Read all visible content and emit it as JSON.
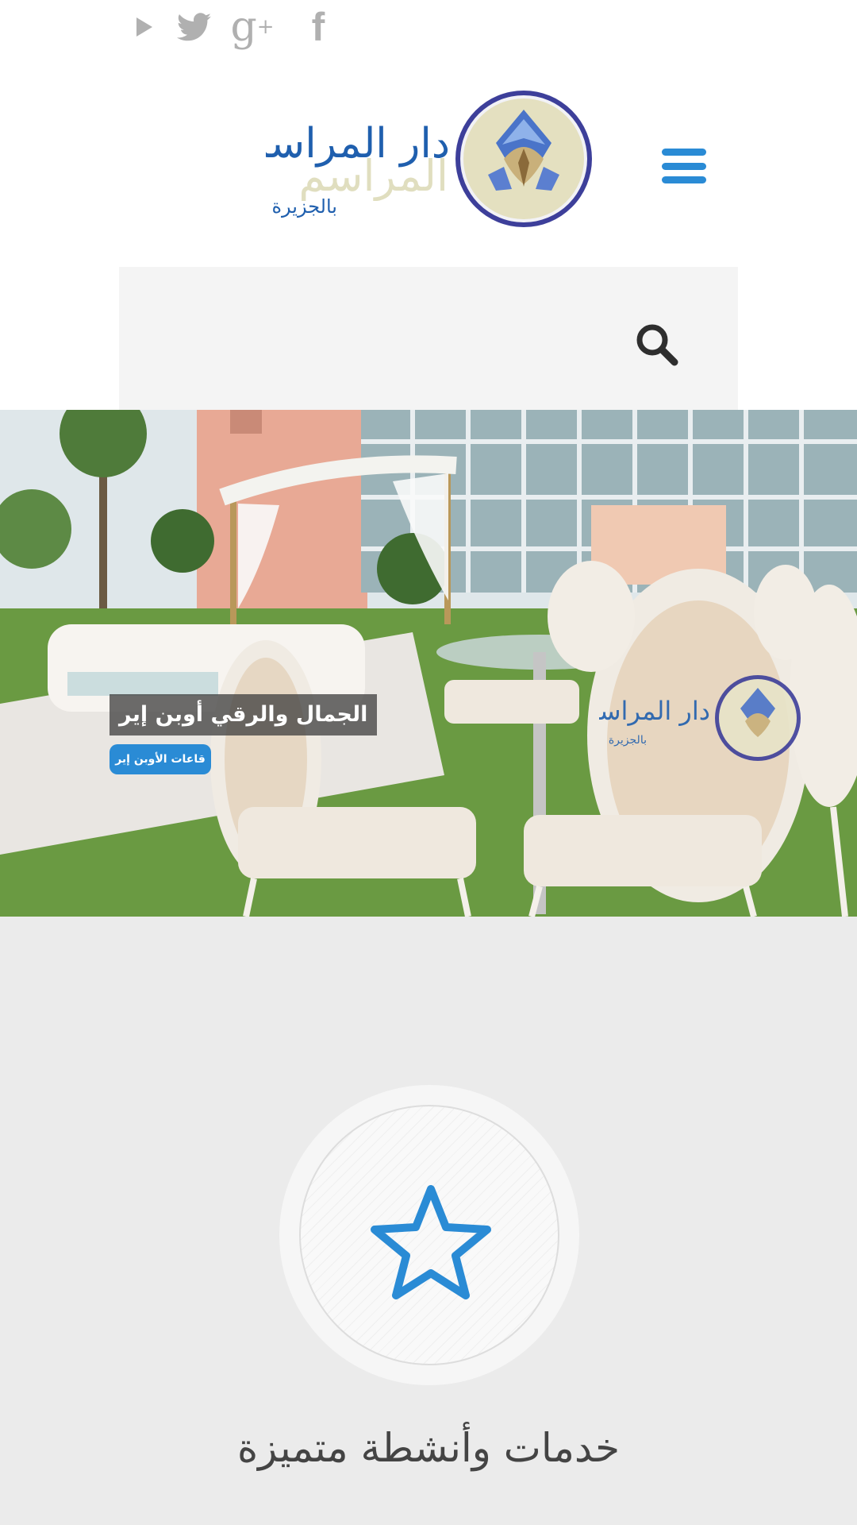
{
  "social": {
    "icons": [
      "youtube-play-icon",
      "twitter-icon",
      "google-plus-icon",
      "facebook-icon"
    ],
    "google_plus_glyph": "g",
    "google_plus_sup": "+",
    "facebook_glyph": "f",
    "icon_color": "#b0b0b0"
  },
  "header": {
    "logo_alt": "دار المراسم بالجزيرة",
    "logo_line1": "دار المراسم",
    "logo_line2": "بالجزيرة",
    "menu_icon": "hamburger-menu-icon",
    "accent_color": "#2a8bd5"
  },
  "search": {
    "icon": "search-icon"
  },
  "hero": {
    "title": "الجمال والرقي أوبن إير",
    "button_label": "قاعات الأوبن إير"
  },
  "features": {
    "icon": "star-icon",
    "title": "خدمات وأنشطة متميزة"
  }
}
